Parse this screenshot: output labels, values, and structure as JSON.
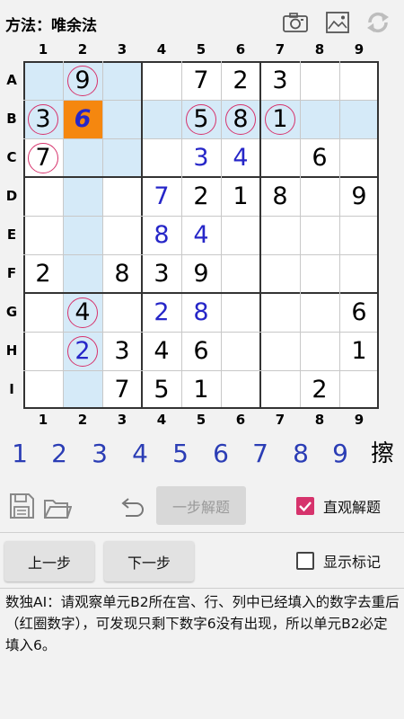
{
  "header": {
    "method_title": "方法：唯余法",
    "icons": [
      "camera-icon",
      "image-icon",
      "refresh-icon"
    ]
  },
  "column_labels": [
    "1",
    "2",
    "3",
    "4",
    "5",
    "6",
    "7",
    "8",
    "9"
  ],
  "row_labels": [
    "A",
    "B",
    "C",
    "D",
    "E",
    "F",
    "G",
    "H",
    "I"
  ],
  "board": {
    "rows": [
      [
        "",
        "9",
        "",
        "",
        "7",
        "2",
        "3",
        "",
        ""
      ],
      [
        "3",
        "6",
        "",
        "",
        "5",
        "8",
        "1",
        "",
        ""
      ],
      [
        "7",
        "",
        "",
        "",
        "3",
        "4",
        "",
        "6",
        ""
      ],
      [
        "",
        "",
        "",
        "7",
        "2",
        "1",
        "8",
        "",
        "9"
      ],
      [
        "",
        "",
        "",
        "8",
        "4",
        "",
        "",
        "",
        ""
      ],
      [
        "2",
        "",
        "8",
        "3",
        "9",
        "",
        "",
        "",
        ""
      ],
      [
        "",
        "4",
        "",
        "2",
        "8",
        "",
        "",
        "",
        "6"
      ],
      [
        "",
        "2",
        "3",
        "4",
        "6",
        "",
        "",
        "",
        "1"
      ],
      [
        "",
        "",
        "7",
        "5",
        "1",
        "",
        "",
        "2",
        ""
      ]
    ],
    "user_cells": [
      "C5",
      "C6",
      "D4",
      "E4",
      "E5",
      "G4",
      "G5",
      "H2"
    ],
    "circled_cells": [
      "A2",
      "B1",
      "B5",
      "B6",
      "B7",
      "C1",
      "G2",
      "H2"
    ],
    "target_cell": "B2",
    "highlight_cells": [
      "A1",
      "A2",
      "A3",
      "B1",
      "B3",
      "B4",
      "B5",
      "B6",
      "B7",
      "B8",
      "B9",
      "C2",
      "C3",
      "D2",
      "E2",
      "F2",
      "G2",
      "H2",
      "I2"
    ],
    "colors": {
      "highlight": "#d5eaf8",
      "target": "#f5870f",
      "user_digit": "#2626c8",
      "circle": "#d6336c"
    }
  },
  "number_pad": {
    "digits": [
      "1",
      "2",
      "3",
      "4",
      "5",
      "6",
      "7",
      "8",
      "9"
    ],
    "erase_label": "擦",
    "digit_color": "#2b3db5"
  },
  "toolbar": {
    "icons": [
      "save-icon",
      "open-folder-icon",
      "undo-icon"
    ],
    "solve_step_label": "一步解题",
    "visual_solve_label": "直观解题",
    "visual_solve_checked": true,
    "accent_color": "#d6336c"
  },
  "navigation": {
    "prev_label": "上一步",
    "next_label": "下一步",
    "show_marks_label": "显示标记",
    "show_marks_checked": false
  },
  "ai_hint": "数独AI：请观察单元B2所在宫、行、列中已经填入的数字去重后（红圈数字），可发现只剩下数字6没有出现，所以单元B2必定填入6。"
}
